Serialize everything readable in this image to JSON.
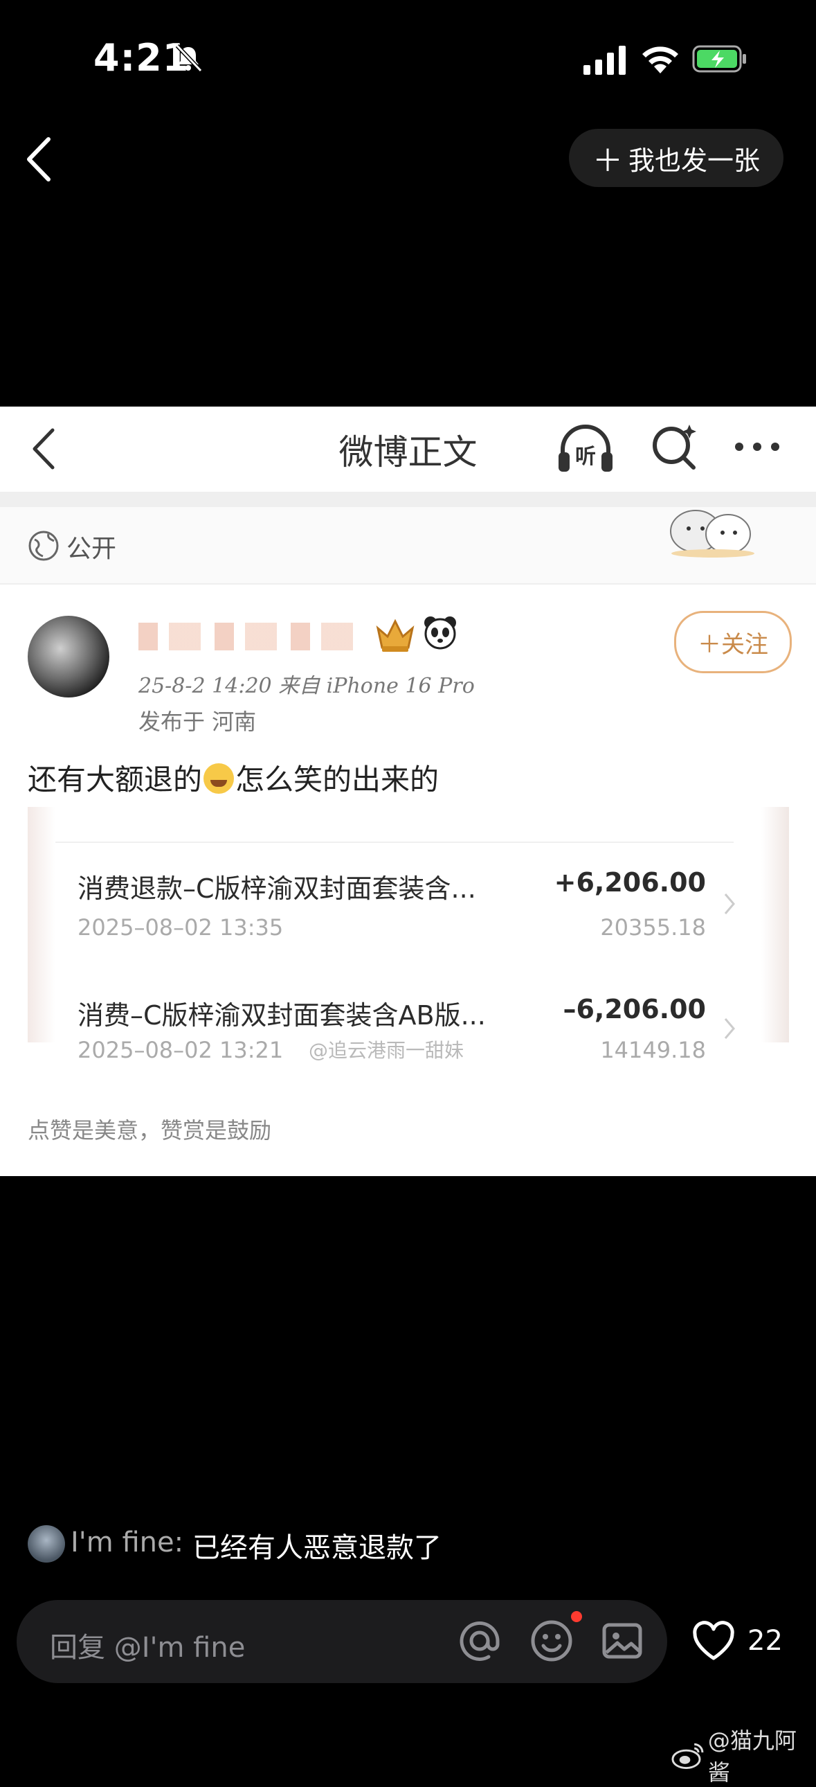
{
  "status_bar": {
    "time": "4:21"
  },
  "nav": {
    "post_button_label": "我也发一张"
  },
  "card": {
    "title": "微博正文",
    "listen_label": "听",
    "visibility": "公开",
    "follow_label": "关注",
    "meta": "25-8-2 14:20  来自 iPhone 16 Pro",
    "location": "发布于 河南",
    "text_before_emoji": "还有大额退的",
    "text_after_emoji": "怎么笑的出来的",
    "transactions": [
      {
        "title": "消费退款–C版梓渝双封面套装含...",
        "amount": "+6,206.00",
        "date": "2025–08–02 13:35",
        "balance": "20355.18"
      },
      {
        "title": "消费–C版梓渝双封面套装含AB版...",
        "amount": "–6,206.00",
        "date": "2025–08–02 13:21",
        "balance": "14149.18"
      }
    ],
    "watermark": "@追云港雨一甜妹",
    "footer": "点赞是美意，赞赏是鼓励"
  },
  "comment": {
    "user": "I'm fine:",
    "text": "已经有人恶意退款了"
  },
  "bottom_bar": {
    "reply_placeholder": "回复 @I'm fine",
    "likes": "22"
  },
  "weibo_watermark": "@猫九阿酱"
}
